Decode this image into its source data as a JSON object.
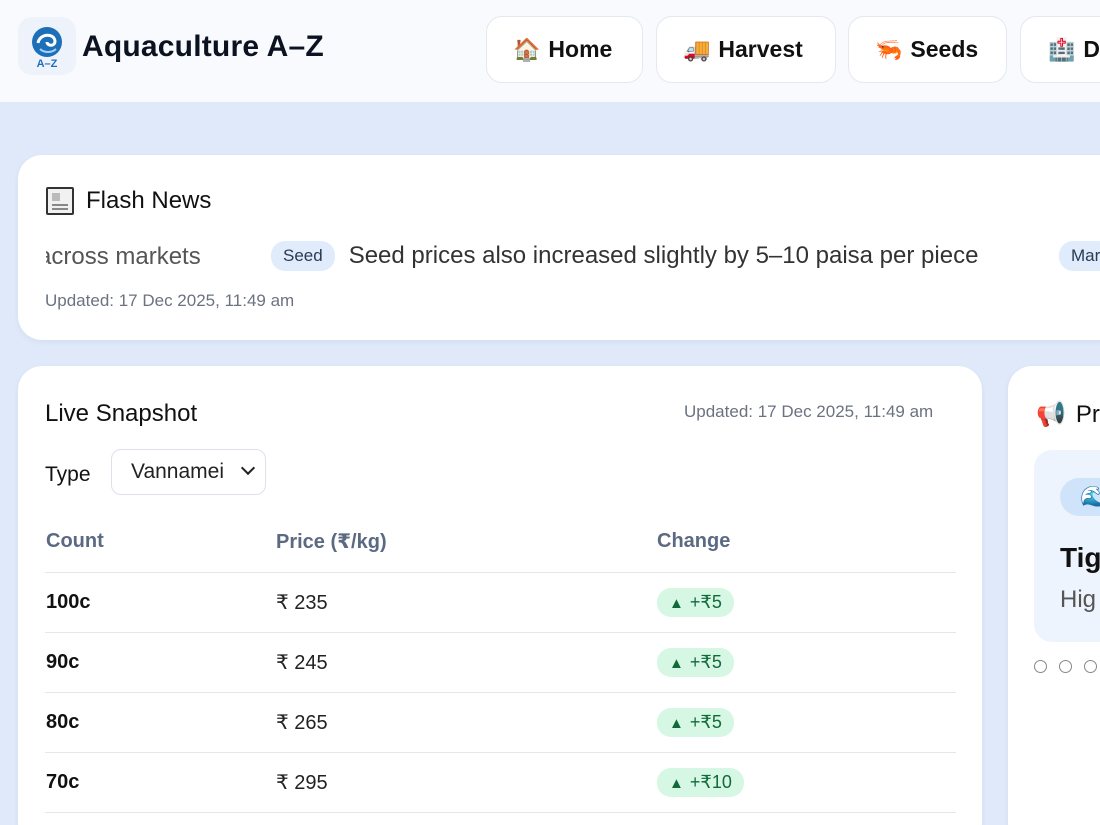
{
  "header": {
    "brand": "Aquaculture A–Z",
    "logo_text": "A–Z",
    "nav": [
      {
        "label": "Home",
        "icon": "house-icon",
        "emoji": "🏠"
      },
      {
        "label": "Harvest",
        "icon": "truck-icon",
        "emoji": "🚚"
      },
      {
        "label": "Seeds",
        "icon": "shrimp-icon",
        "emoji": "🦐"
      },
      {
        "label": "D",
        "icon": "hospital-icon",
        "emoji": "🏥"
      }
    ]
  },
  "flash": {
    "title": "Flash News",
    "ticker": [
      {
        "tag": "",
        "text": "across markets"
      },
      {
        "tag": "Seed",
        "text": "Seed prices also increased slightly by 5–10 paisa per piece"
      },
      {
        "tag": "Mar",
        "text": ""
      }
    ],
    "updated": "Updated: 17 Dec 2025, 11:49 am"
  },
  "live": {
    "title": "Live Snapshot",
    "updated": "Updated: 17 Dec 2025, 11:49 am",
    "type_label": "Type",
    "type_value": "Vannamei",
    "columns": [
      "Count",
      "Price (₹/kg)",
      "Change"
    ],
    "rows": [
      {
        "count": "100c",
        "price": "₹ 235",
        "change": "+₹5"
      },
      {
        "count": "90c",
        "price": "₹ 245",
        "change": "+₹5"
      },
      {
        "count": "80c",
        "price": "₹ 265",
        "change": "+₹5"
      },
      {
        "count": "70c",
        "price": "₹ 295",
        "change": "+₹10"
      }
    ]
  },
  "promo": {
    "title": "Pr",
    "head": "Tig",
    "sub": "Hig"
  },
  "colors": {
    "accent": "#1d6fb8",
    "positive_bg": "#d5f7e4",
    "positive_text": "#126a3a",
    "page_bg": "#dfe9f9"
  }
}
